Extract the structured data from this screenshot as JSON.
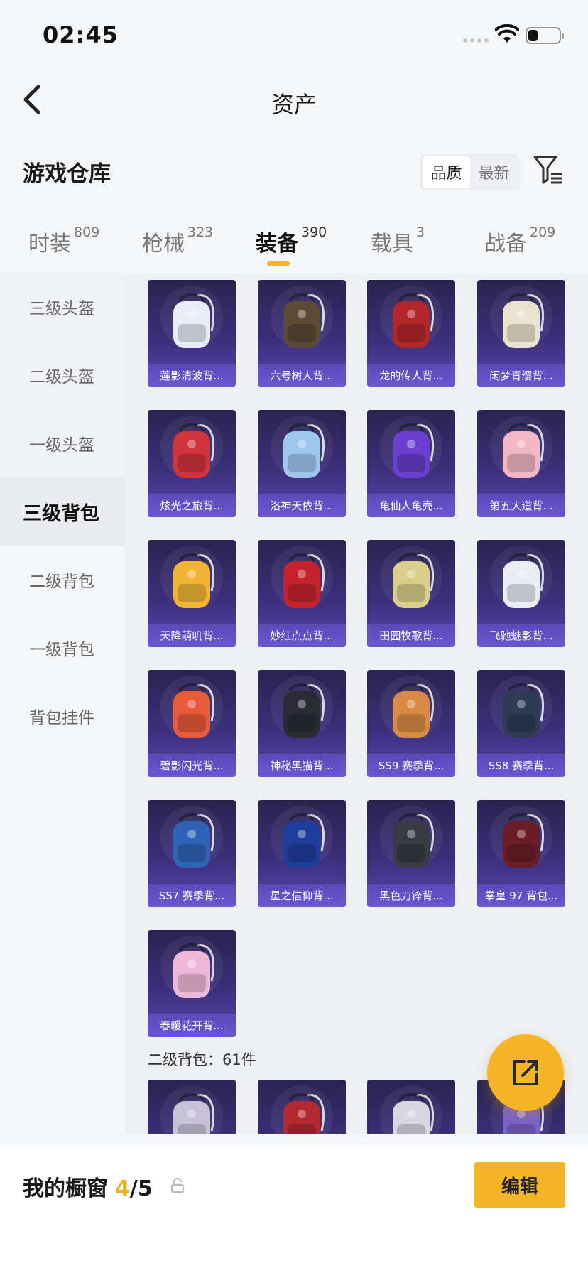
{
  "status_bar": {
    "time": "02:45",
    "battery_level": 0.3
  },
  "header": {
    "title": "资产"
  },
  "section": {
    "title": "游戏仓库",
    "sort_options": [
      "品质",
      "最新"
    ],
    "active_sort": "品质"
  },
  "tabs": [
    {
      "label": "时装",
      "count": "809"
    },
    {
      "label": "枪械",
      "count": "323"
    },
    {
      "label": "装备",
      "count": "390",
      "active": true
    },
    {
      "label": "载具",
      "count": "3"
    },
    {
      "label": "战备",
      "count": "209"
    }
  ],
  "sidebar": {
    "items": [
      {
        "label": "三级头盔"
      },
      {
        "label": "二级头盔"
      },
      {
        "label": "一级头盔"
      },
      {
        "label": "三级背包",
        "active": true
      },
      {
        "label": "二级背包"
      },
      {
        "label": "一级背包"
      },
      {
        "label": "背包挂件"
      }
    ]
  },
  "items": [
    {
      "name": "莲影清波背...",
      "icon": "white-lotus-backpack-icon",
      "color": "#e8eef8"
    },
    {
      "name": "六号树人背...",
      "icon": "treant-backpack-icon",
      "color": "#5b4a34"
    },
    {
      "name": "龙的传人背...",
      "icon": "dragon-backpack-icon",
      "color": "#b3262a"
    },
    {
      "name": "闲梦青缨背...",
      "icon": "cream-flower-backpack-icon",
      "color": "#e9e4cf"
    },
    {
      "name": "炫光之旅背...",
      "icon": "monster-backpack-icon",
      "color": "#d1343c"
    },
    {
      "name": "洛神天依背...",
      "icon": "blue-fairy-backpack-icon",
      "color": "#9fc6ef"
    },
    {
      "name": "龟仙人龟壳...",
      "icon": "turtle-shell-backpack-icon",
      "color": "#6b3fcf"
    },
    {
      "name": "第五大道背...",
      "icon": "pink-quilted-backpack-icon",
      "color": "#f2b7c4"
    },
    {
      "name": "天降萌叽背...",
      "icon": "yellow-chick-backpack-icon",
      "color": "#f2b434"
    },
    {
      "name": "妙红点点背...",
      "icon": "red-bow-backpack-icon",
      "color": "#c4232d"
    },
    {
      "name": "田园牧歌背...",
      "icon": "flower-basket-backpack-icon",
      "color": "#d9cf8a"
    },
    {
      "name": "飞驰魅影背...",
      "icon": "racing-white-backpack-icon",
      "color": "#e9edf4"
    },
    {
      "name": "碧影闪光背...",
      "icon": "gamepad-backpack-icon",
      "color": "#e85a3a"
    },
    {
      "name": "神秘黑猫背...",
      "icon": "black-cat-backpack-icon",
      "color": "#2b2b34"
    },
    {
      "name": "SS9 赛季背...",
      "icon": "season9-backpack-icon",
      "color": "#d98b45"
    },
    {
      "name": "SS8 赛季背...",
      "icon": "season8-backpack-icon",
      "color": "#2d3b55"
    },
    {
      "name": "SS7 赛季背...",
      "icon": "season7-backpack-icon",
      "color": "#2f63b8"
    },
    {
      "name": "星之信仰背...",
      "icon": "starry-blue-backpack-icon",
      "color": "#1f3e9c"
    },
    {
      "name": "黑色刀锋背...",
      "icon": "black-blade-backpack-icon",
      "color": "#3a3a44"
    },
    {
      "name": "拳皇 97 背包...",
      "icon": "kof97-backpack-icon",
      "color": "#6a1d27"
    },
    {
      "name": "春暖花开背...",
      "icon": "butterfly-backpack-icon",
      "color": "#f0b8d8"
    }
  ],
  "sub_section": {
    "label": "二级背包：61件"
  },
  "peek_items": [
    {
      "icon": "level2-backpack-a-icon",
      "color": "#c8c2d8"
    },
    {
      "icon": "level2-backpack-b-icon",
      "color": "#b22a30"
    },
    {
      "icon": "level2-backpack-c-icon",
      "color": "#d8d6e2"
    },
    {
      "icon": "level2-backpack-d-icon",
      "color": "#7a63c8"
    }
  ],
  "showcase": {
    "title": "我的橱窗",
    "current": "4",
    "total": "/5",
    "edit_label": "编辑"
  },
  "colors": {
    "accent": "#f6b527",
    "card_top": "#2a2350",
    "card_label": "#6c56d2"
  }
}
